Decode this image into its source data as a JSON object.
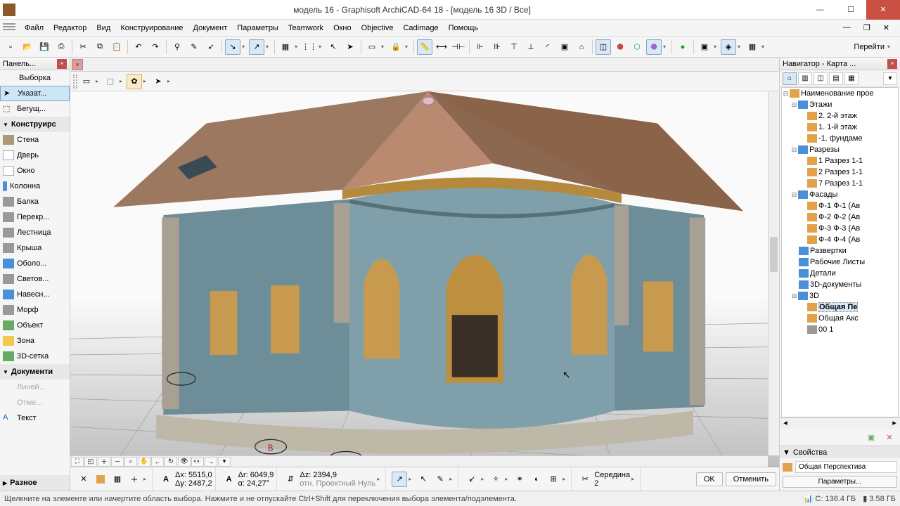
{
  "title": "модель 16 - Graphisoft ArchiCAD-64 18 - [модель 16 3D / Все]",
  "menu": [
    "Файл",
    "Редактор",
    "Вид",
    "Конструирование",
    "Документ",
    "Параметры",
    "Teamwork",
    "Окно",
    "Objective",
    "Cadimage",
    "Помощь"
  ],
  "goto": "Перейти",
  "toolbox": {
    "title": "Панель...",
    "selection": "Выборка",
    "pointer": "Указат...",
    "marquee": "Бегущ...",
    "construct_hdr": "Конструирс",
    "tools": [
      "Стена",
      "Дверь",
      "Окно",
      "Колонна",
      "Балка",
      "Перекр...",
      "Лестница",
      "Крыша",
      "Оболо...",
      "Светов...",
      "Навесн...",
      "Морф",
      "Объект",
      "Зона",
      "3D-сетка"
    ],
    "doc_hdr": "Документи",
    "doc_tools": [
      "Линей...",
      "Отме...",
      "Текст"
    ],
    "misc": "Разное"
  },
  "coords": {
    "dx": "Δx:  5515,0",
    "dy": "Δy:  2487,2",
    "dr": "Δr:  6049,9",
    "a": "α:   24,27°",
    "dz": "Δz:  2394,9",
    "ref": "отн. Проектный Нуль",
    "snap": "Середина",
    "snapn": "2",
    "ok": "OK",
    "cancel": "Отменить"
  },
  "navigator": {
    "title": "Навигатор - Карта ...",
    "root": "Наименование прое",
    "stories_hdr": "Этажи",
    "stories": [
      "2. 2-й этаж",
      "1. 1-й этаж",
      "-1. фундаме"
    ],
    "sections_hdr": "Разрезы",
    "sections": [
      "1 Разрез 1-1",
      "2 Разрез 1-1",
      "7 Разрез 1-1"
    ],
    "elev_hdr": "Фасады",
    "elevs": [
      "Ф-1 Ф-1 (Ав",
      "Ф-2 Ф-2 (Ав",
      "Ф-3 Ф-3 (Ав",
      "Ф-4 Ф-4 (Ав"
    ],
    "unfold": "Развертки",
    "wsheets": "Рабочие Листы",
    "details": "Детали",
    "docs3d": "3D-документы",
    "d3_hdr": "3D",
    "d3": [
      "Общая Пе",
      "Общая Акс",
      "00 1"
    ],
    "props_hdr": "Свойства",
    "props_val": "Общая Перспектива",
    "params_btn": "Параметры..."
  },
  "status": {
    "hint": "Щелкните на элементе или начертите область выбора. Нажмите и не отпускайте Ctrl+Shift для переключения выбора элемента/подэлемента.",
    "mem1": "C: 136.4 ГБ",
    "mem2": "3.58 ГБ"
  }
}
